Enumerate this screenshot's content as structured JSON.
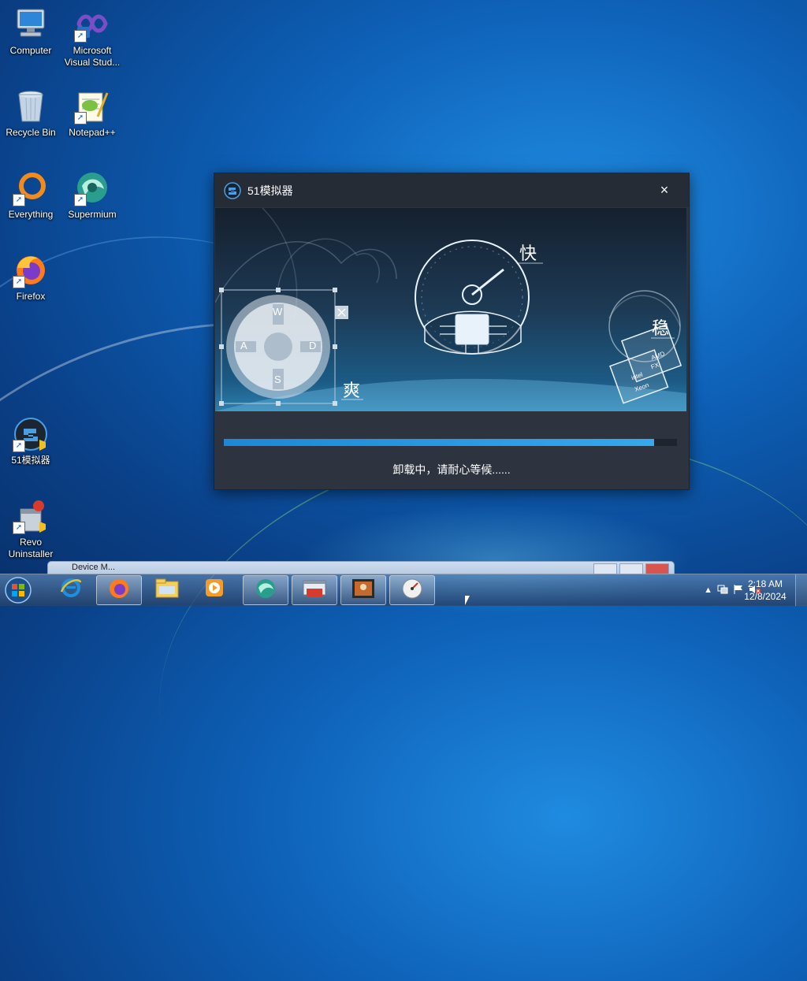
{
  "desktop": {
    "icons": [
      {
        "label": "Computer",
        "icon": "computer-icon"
      },
      {
        "label": "Microsoft Visual Stud...",
        "icon": "visual-studio-icon"
      },
      {
        "label": "Recycle Bin",
        "icon": "recycle-bin-icon"
      },
      {
        "label": "Notepad++",
        "icon": "notepadpp-icon"
      },
      {
        "label": "Everything",
        "icon": "everything-icon"
      },
      {
        "label": "Supermium",
        "icon": "supermium-icon"
      },
      {
        "label": "Firefox",
        "icon": "firefox-icon"
      },
      {
        "label": "51模拟器",
        "icon": "emulator-icon"
      },
      {
        "label": "Revo Uninstaller",
        "icon": "revo-uninstaller-icon"
      }
    ]
  },
  "dialog": {
    "title": "51模拟器",
    "close_label": "×",
    "banner": {
      "char_fast": "快",
      "char_stable": "稳",
      "char_cool": "爽",
      "keys": {
        "w": "W",
        "a": "A",
        "s": "S",
        "d": "D"
      },
      "chip_amd": "AMD",
      "chip_fx": "FX",
      "chip_intel": "intel",
      "chip_xeon": "Xeon"
    },
    "progress": 0.95,
    "status": "卸载中，请耐心等候......"
  },
  "background_window": {
    "title": "Device M..."
  },
  "taskbar": {
    "buttons": [
      {
        "icon": "internet-explorer-icon"
      },
      {
        "icon": "firefox-icon"
      },
      {
        "icon": "file-explorer-icon"
      },
      {
        "icon": "media-player-icon"
      },
      {
        "icon": "supermium-icon"
      },
      {
        "icon": "toolbox-icon"
      },
      {
        "icon": "photo-icon"
      },
      {
        "icon": "gauge-icon"
      }
    ],
    "clock_time": "2:18 AM",
    "clock_date": "12/8/2024"
  },
  "colors": {
    "accent": "#36a8ee",
    "dialog_bg": "#2d3440"
  }
}
